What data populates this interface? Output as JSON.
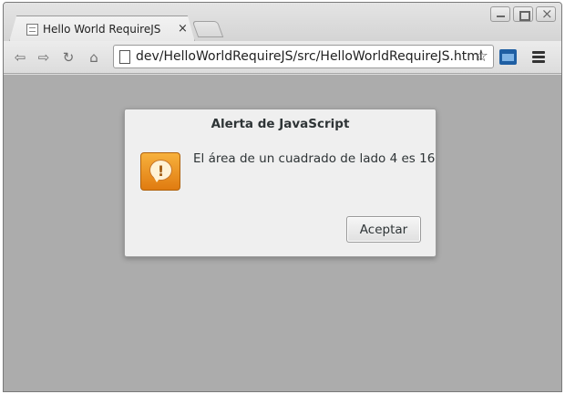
{
  "browser": {
    "tab": {
      "title": "Hello World RequireJS",
      "close_glyph": "×"
    },
    "toolbar": {
      "url": "dev/HelloWorldRequireJS/src/HelloWorldRequireJS.html",
      "back_glyph": "⇦",
      "forward_glyph": "⇨",
      "reload_glyph": "↻",
      "home_glyph": "⌂",
      "star_glyph": "☆"
    },
    "icons": [
      "page-icon",
      "back-icon",
      "forward-icon",
      "reload-icon",
      "home-icon",
      "star-icon",
      "extension-icon",
      "menu-icon",
      "minimize-icon",
      "maximize-icon",
      "close-icon"
    ]
  },
  "dialog": {
    "title": "Alerta de JavaScript",
    "message": "El área de un cuadrado de lado 4 es 16",
    "icon_mark": "!",
    "button_label": "Aceptar"
  },
  "colors": {
    "content_background": "#acacac",
    "dialog_background": "#efefef",
    "warning_icon": "#f0961f"
  }
}
